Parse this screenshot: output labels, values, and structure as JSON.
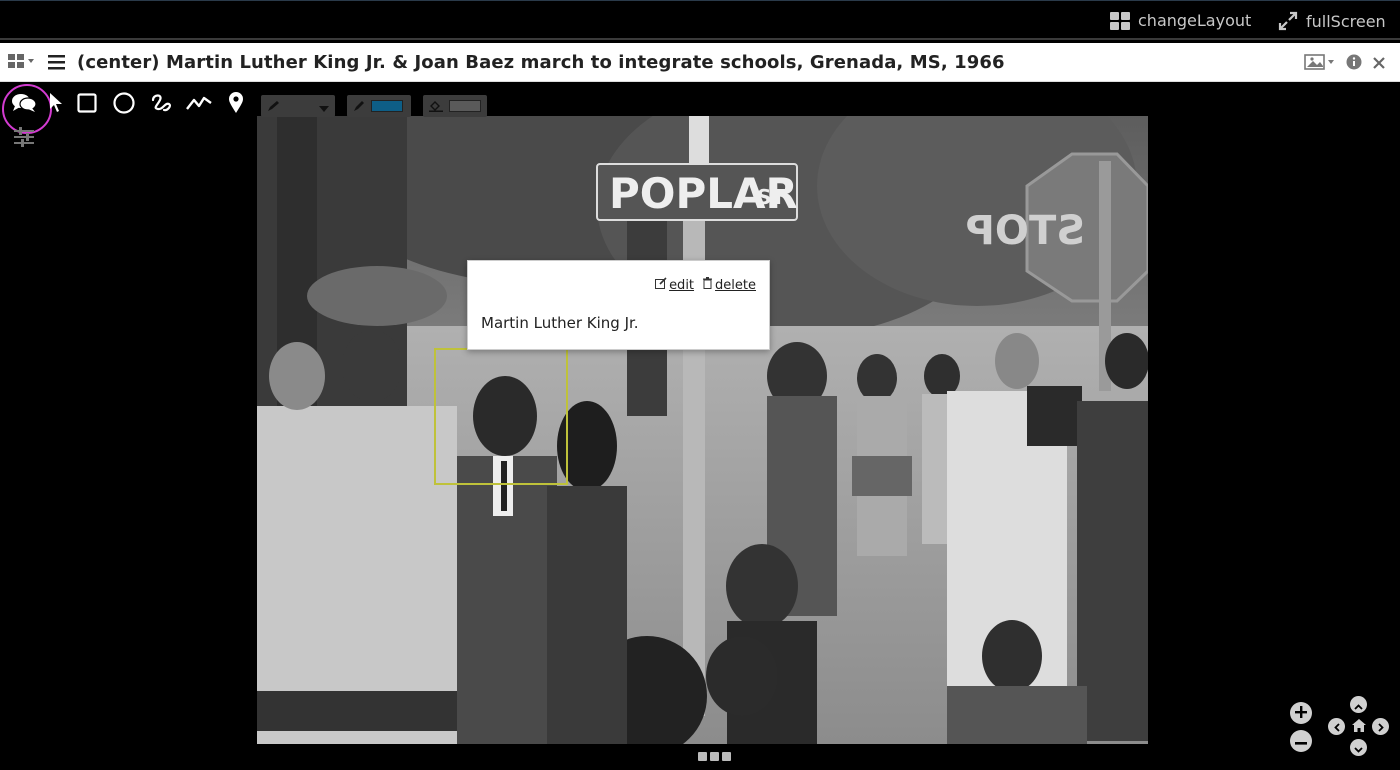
{
  "topbar": {
    "change_layout": "changeLayout",
    "full_screen": "fullScreen"
  },
  "titlebar": {
    "title": "(center) Martin Luther King Jr. & Joan Baez march to integrate schools, Grenada, MS, 1966"
  },
  "toolbar": {
    "tools": [
      "comment-icon",
      "pointer-icon",
      "rectangle-icon",
      "circle-icon",
      "freehand-icon",
      "polyline-icon",
      "pin-icon"
    ],
    "stroke_color": "#0e5e86",
    "fill_color": "#5a5a5a"
  },
  "photo": {
    "sign_text": "POPLAR",
    "sign_suffix": "ST",
    "stop_text": "STOP"
  },
  "annotation": {
    "edit_label": "edit",
    "delete_label": "delete",
    "text": "Martin Luther King Jr.",
    "box_color": "#bfc23a"
  },
  "colors": {
    "highlight": "#d33bd1"
  }
}
